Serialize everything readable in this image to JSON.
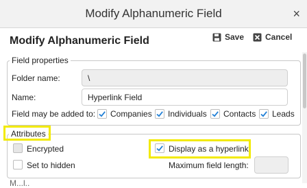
{
  "window": {
    "title": "Modify Alphanumeric Field",
    "close_glyph": "×"
  },
  "panel": {
    "title": "Modify Alphanumeric Field"
  },
  "toolbar": {
    "save_label": "Save",
    "cancel_label": "Cancel"
  },
  "field_properties": {
    "legend": "Field properties",
    "folder_name_label": "Folder name:",
    "folder_name_value": "\\",
    "name_label": "Name:",
    "name_value": "Hyperlink Field",
    "may_be_added_label": "Field may be added to:",
    "targets": [
      {
        "label": "Companies",
        "checked": true
      },
      {
        "label": "Individuals",
        "checked": true
      },
      {
        "label": "Contacts",
        "checked": true
      },
      {
        "label": "Leads",
        "checked": true
      }
    ]
  },
  "attributes": {
    "legend": "Attributes",
    "encrypted_label": "Encrypted",
    "encrypted_checked": false,
    "hidden_label": "Set to hidden",
    "hidden_checked": false,
    "hyperlink_label": "Display as a hyperlink",
    "hyperlink_checked": true,
    "max_length_label": "Maximum field length:",
    "max_length_value": ""
  },
  "next_section_partial": "M...l..",
  "colors": {
    "highlight": "#f2ea00",
    "check": "#1f7fd6"
  }
}
